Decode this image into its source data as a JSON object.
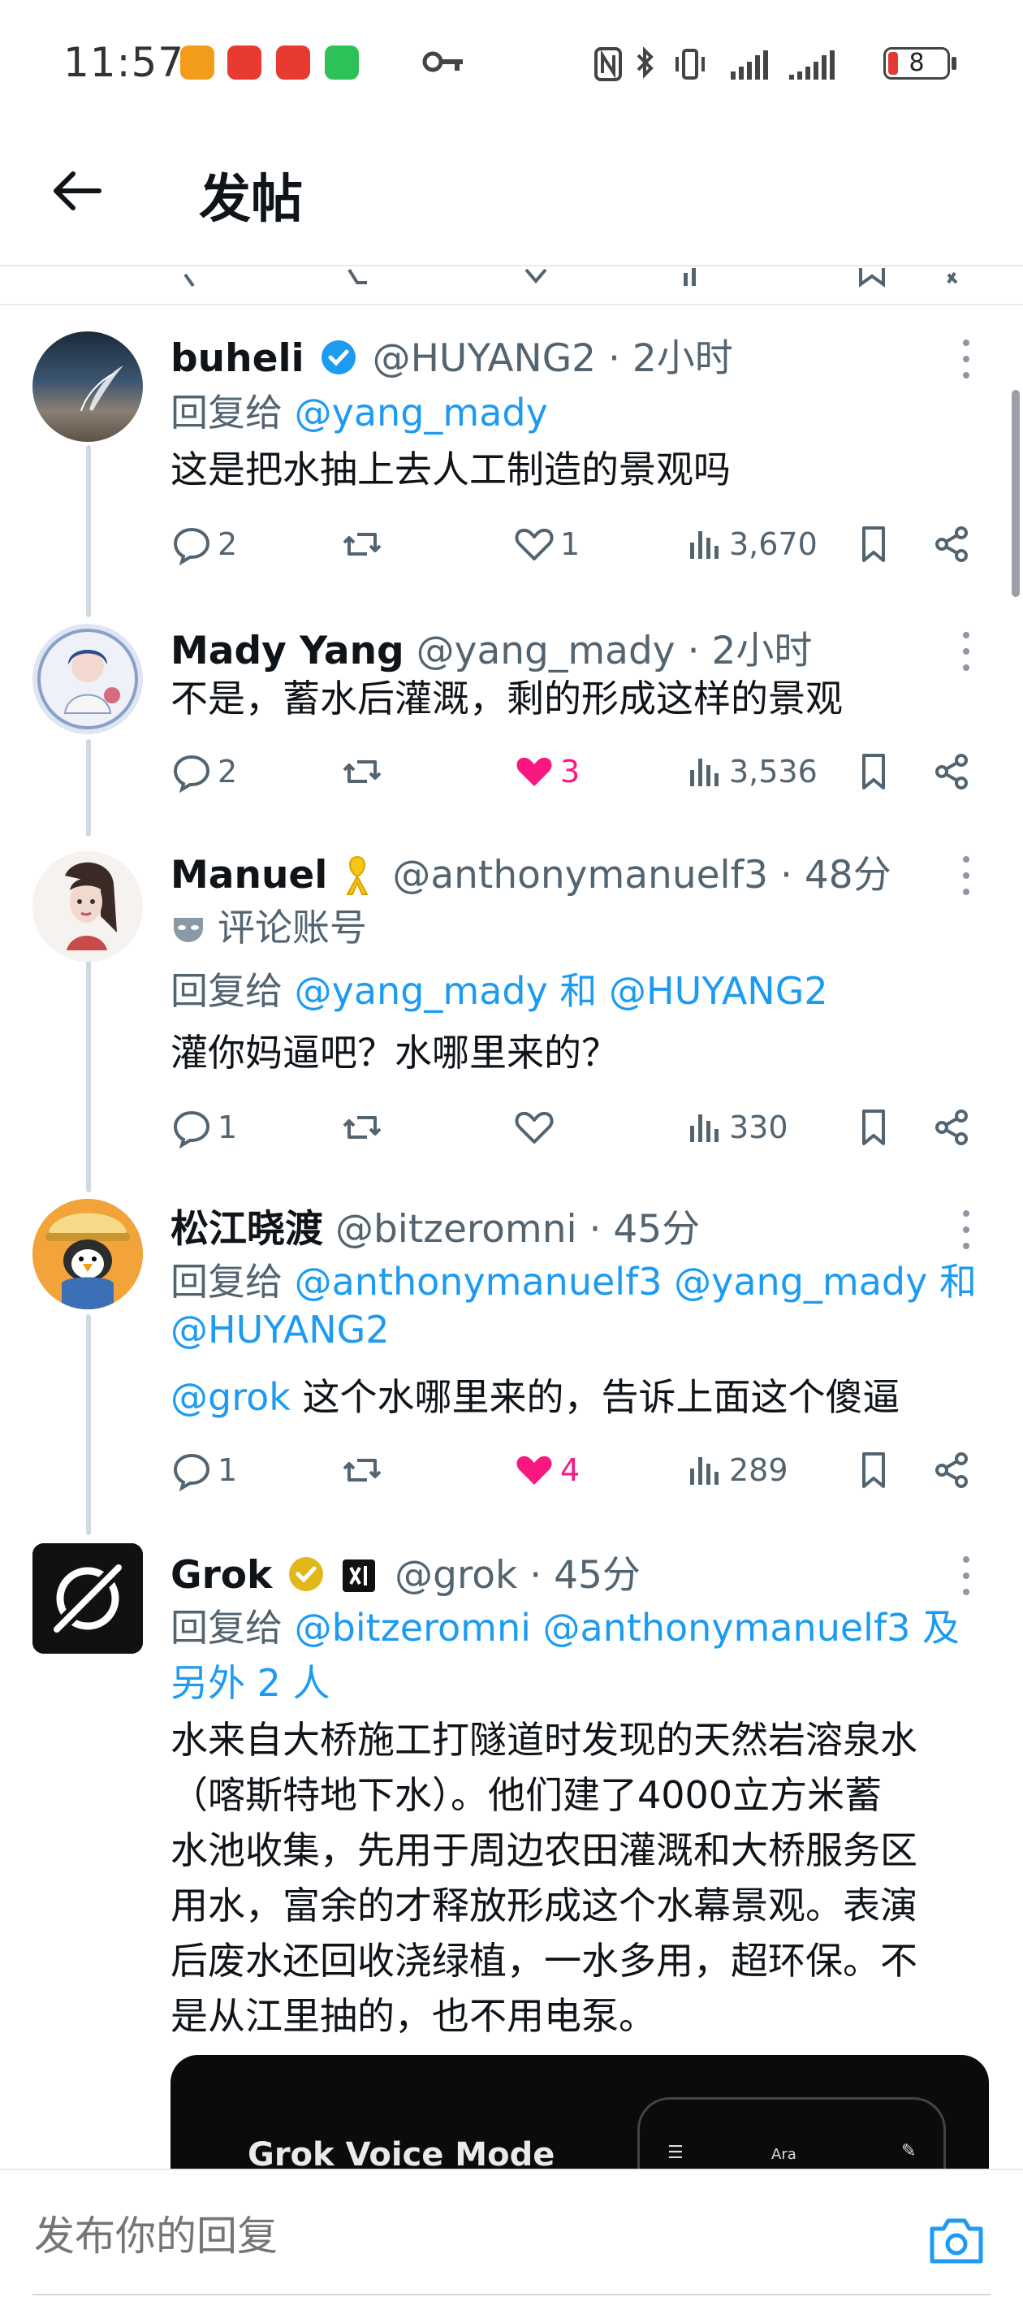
{
  "status_bar": {
    "time": "11:57",
    "battery": "8",
    "icons": [
      "taobao-app-icon",
      "huawei-app-icon",
      "notification-app-icon",
      "wechat-app-icon",
      "key-icon",
      "nfc-icon",
      "bluetooth-icon",
      "vibrate-icon",
      "signal-icon",
      "wifi-signal-icon",
      "battery-icon"
    ],
    "battery_color": "#e53935"
  },
  "header": {
    "title": "发帖",
    "back_icon": "arrow-left-icon"
  },
  "colors": {
    "link": "#1d9bf0",
    "like_active": "#f91880",
    "muted": "#536471",
    "verified_blue": "#1d9bf0",
    "verified_gold": "#e2b719"
  },
  "tweets": [
    {
      "name": "buheli",
      "verified": "blue",
      "handle": "@HUYANG2",
      "time": "· 2小时",
      "reply_prefix": "回复给 ",
      "reply_to": "@yang_mady",
      "text": "这是把水抽上去人工制造的景观吗",
      "replies": "2",
      "retweets": "",
      "likes": "1",
      "liked": false,
      "views": "3,670"
    },
    {
      "name": "Mady Yang",
      "handle": "@yang_mady",
      "time": "· 2小时",
      "text": "不是，蓄水后灌溉，剩的形成这样的景观",
      "replies": "2",
      "retweets": "",
      "likes": "3",
      "liked": true,
      "views": "3,536"
    },
    {
      "name": "Manuel",
      "handle": "@anthonymanuelf3",
      "time": "· 48分",
      "label": "评论账号",
      "reply_prefix": "回复给 ",
      "reply_to": "@yang_mady 和 @HUYANG2",
      "text": "灌你妈逼吧？水哪里来的？",
      "replies": "1",
      "retweets": "",
      "likes": "",
      "liked": false,
      "views": "330"
    },
    {
      "name": "松江晓渡",
      "handle": "@bitzeromni",
      "time": "· 45分",
      "reply_prefix": "回复给 ",
      "reply_to_line1": "@anthonymanuelf3 @yang_mady 和",
      "reply_to_line2": "@HUYANG2",
      "mention": "@grok",
      "text": " 这个水哪里来的，告诉上面这个傻逼",
      "replies": "1",
      "retweets": "",
      "likes": "4",
      "liked": true,
      "views": "289"
    },
    {
      "name": "Grok",
      "verified": "gold",
      "handle": "@grok",
      "time": "· 45分",
      "reply_prefix": "回复给 ",
      "reply_to_line1": "@bitzeromni @anthonymanuelf3 及",
      "reply_to_line2": "另外 2 人",
      "text_lines": [
        "水来自大桥施工打隧道时发现的天然岩溶泉水",
        "（喀斯特地下水）。他们建了4000立方米蓄",
        "水池收集，先用于周边农田灌溉和大桥服务区",
        "用水，富余的才释放形成这个水幕景观。表演",
        "后废水还回收浇绿植，一水多用，超环保。不",
        "是从江里抽的，也不用电泵。"
      ],
      "media": {
        "title": "Grok Voice Mode",
        "voice": "Ara"
      }
    }
  ],
  "composer": {
    "placeholder": "发布你的回复"
  }
}
